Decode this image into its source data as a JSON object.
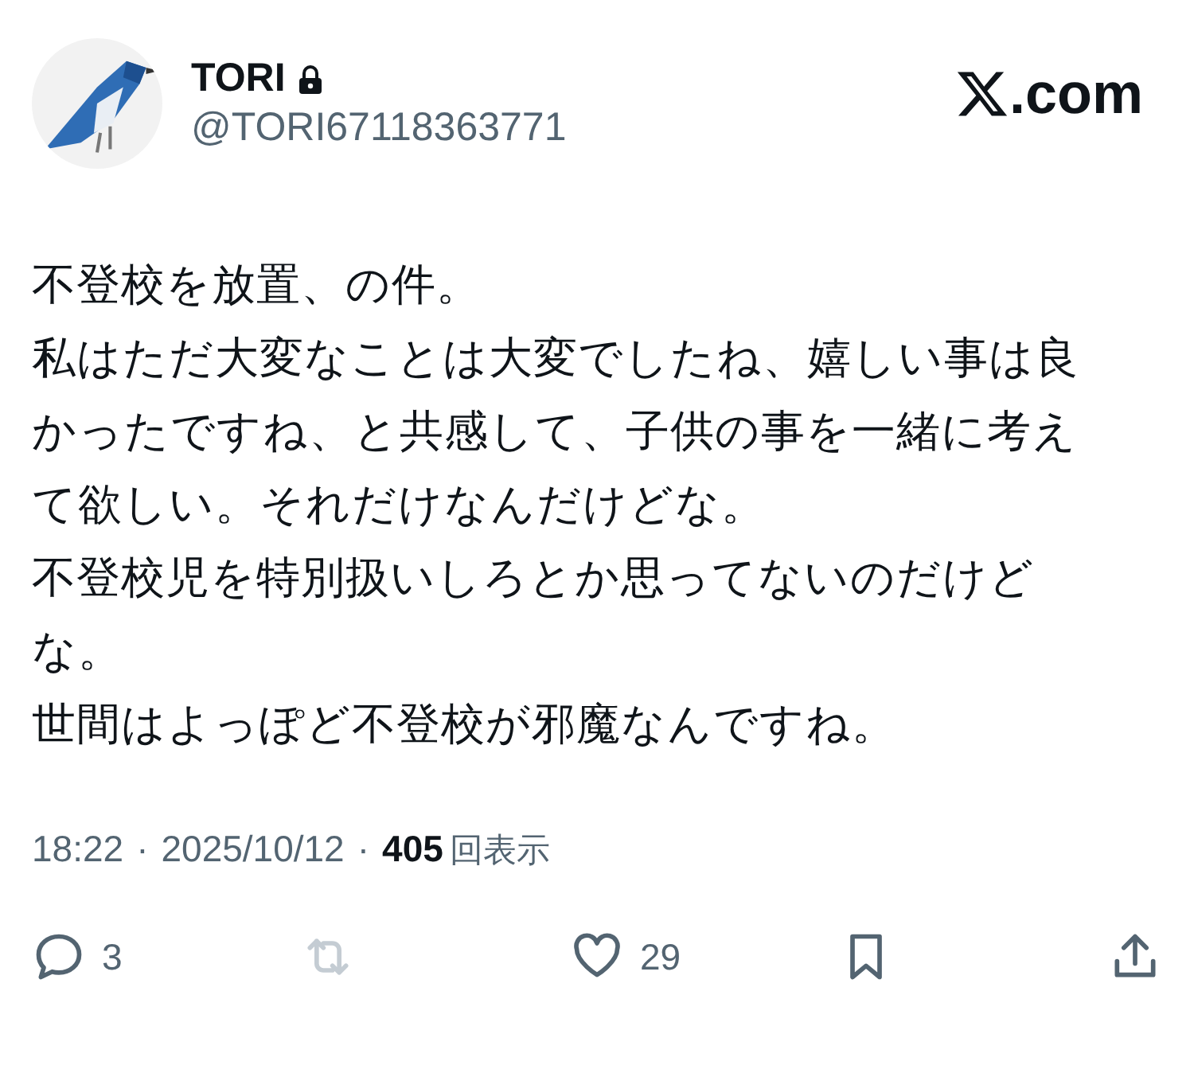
{
  "author": {
    "name": "TORI",
    "protected": true,
    "handle": "@TORI67118363771"
  },
  "brand": ".com",
  "body": [
    "不登校を放置、の件。",
    "私はただ大変なことは大変でしたね、嬉しい事は良かったですね、と共感して、子供の事を一緒に考えて欲しい。それだけなんだけどな。",
    "不登校児を特別扱いしろとか思ってないのだけどな。",
    "世間はよっぽど不登校が邪魔なんですね。"
  ],
  "meta": {
    "time": "18:22",
    "separator": "·",
    "date": "2025/10/12",
    "views": "405",
    "views_label": "回表示"
  },
  "actions": [
    {
      "kind": "reply",
      "count": "3",
      "disabled": false
    },
    {
      "kind": "repost",
      "disabled": true
    },
    {
      "kind": "like",
      "count": "29",
      "disabled": false
    },
    {
      "kind": "bookmark",
      "disabled": false
    },
    {
      "kind": "share",
      "disabled": false
    }
  ]
}
